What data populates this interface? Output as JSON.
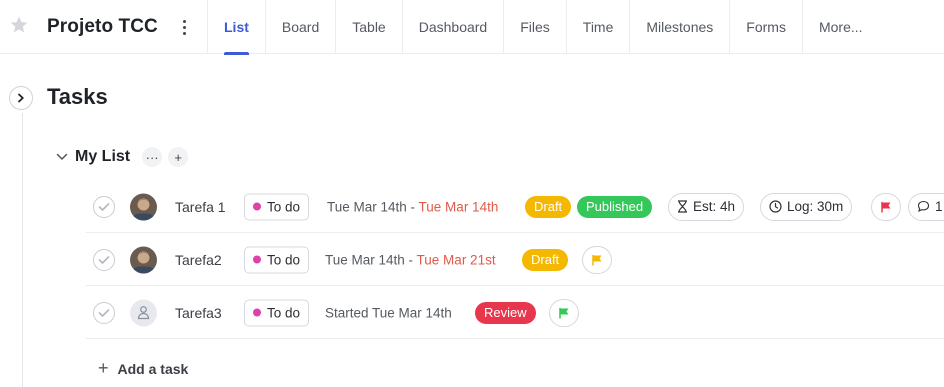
{
  "header": {
    "project_title": "Projeto TCC",
    "tabs": [
      {
        "label": "List",
        "active": true
      },
      {
        "label": "Board"
      },
      {
        "label": "Table"
      },
      {
        "label": "Dashboard"
      },
      {
        "label": "Files"
      },
      {
        "label": "Time"
      },
      {
        "label": "Milestones"
      },
      {
        "label": "Forms"
      },
      {
        "label": "More..."
      }
    ]
  },
  "page": {
    "title": "Tasks"
  },
  "list": {
    "title": "My List",
    "more_label": "···",
    "add_label": "+"
  },
  "tasks": [
    {
      "name": "Tarefa 1",
      "status": "To do",
      "date_start": "Tue Mar 14th - ",
      "date_end": "Tue Mar 14th",
      "tags": [
        "Draft",
        "Published"
      ],
      "estimate": "Est: 4h",
      "logged": "Log: 30m",
      "comments": "1",
      "flag_color": "#e8374d"
    },
    {
      "name": "Tarefa2",
      "status": "To do",
      "date_start": "Tue Mar 14th - ",
      "date_end": "Tue Mar 21st",
      "tags": [
        "Draft"
      ],
      "flag_color": "#f4b800"
    },
    {
      "name": "Tarefa3",
      "status": "To do",
      "date_start": "Started Tue Mar 14th",
      "tags": [
        "Review"
      ],
      "flag_color": "#34c759"
    }
  ],
  "footer": {
    "add_task_label": "Add a task"
  },
  "colors": {
    "accent": "#3d5bd9",
    "status_dot": "#e040a9",
    "draft": "#f4b800",
    "published": "#34c759",
    "review": "#e8374d",
    "overdue_date": "#e05a4a"
  }
}
